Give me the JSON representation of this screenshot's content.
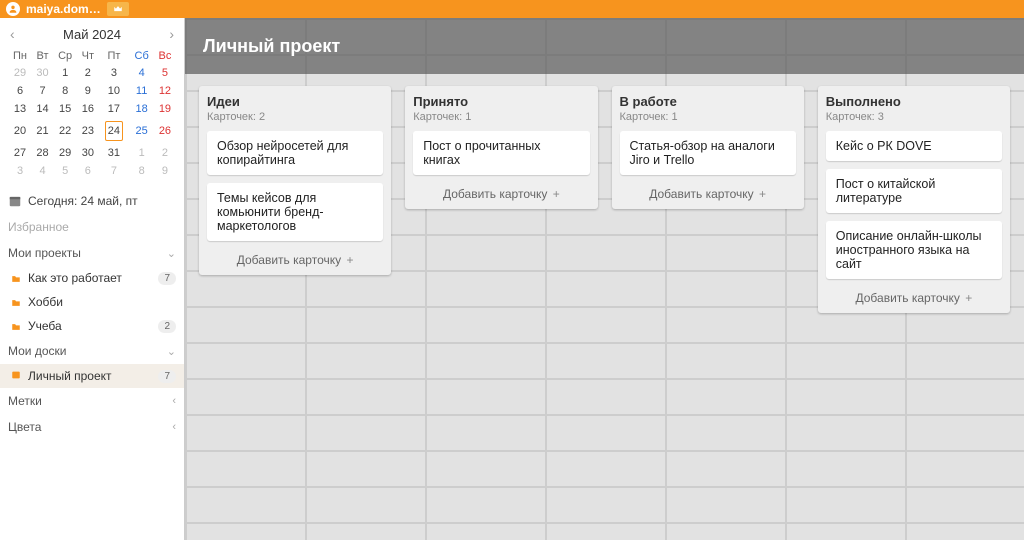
{
  "topbar": {
    "user": "maiya.dom…"
  },
  "calendar": {
    "title": "Май 2024",
    "dow": [
      "Пн",
      "Вт",
      "Ср",
      "Чт",
      "Пт",
      "Сб",
      "Вс"
    ],
    "weeks": [
      [
        {
          "n": 29,
          "cls": "other"
        },
        {
          "n": 30,
          "cls": "other"
        },
        {
          "n": 1
        },
        {
          "n": 2
        },
        {
          "n": 3
        },
        {
          "n": 4,
          "cls": "sat"
        },
        {
          "n": 5,
          "cls": "sun"
        }
      ],
      [
        {
          "n": 6
        },
        {
          "n": 7
        },
        {
          "n": 8
        },
        {
          "n": 9
        },
        {
          "n": 10
        },
        {
          "n": 11,
          "cls": "sat"
        },
        {
          "n": 12,
          "cls": "sun"
        }
      ],
      [
        {
          "n": 13
        },
        {
          "n": 14
        },
        {
          "n": 15
        },
        {
          "n": 16
        },
        {
          "n": 17
        },
        {
          "n": 18,
          "cls": "sat"
        },
        {
          "n": 19,
          "cls": "sun"
        }
      ],
      [
        {
          "n": 20
        },
        {
          "n": 21
        },
        {
          "n": 22
        },
        {
          "n": 23
        },
        {
          "n": 24,
          "today": true
        },
        {
          "n": 25,
          "cls": "sat"
        },
        {
          "n": 26,
          "cls": "sun"
        }
      ],
      [
        {
          "n": 27
        },
        {
          "n": 28
        },
        {
          "n": 29
        },
        {
          "n": 30
        },
        {
          "n": 31
        },
        {
          "n": 1,
          "cls": "other"
        },
        {
          "n": 2,
          "cls": "other"
        }
      ],
      [
        {
          "n": 3,
          "cls": "other"
        },
        {
          "n": 4,
          "cls": "other"
        },
        {
          "n": 5,
          "cls": "other"
        },
        {
          "n": 6,
          "cls": "other"
        },
        {
          "n": 7,
          "cls": "other"
        },
        {
          "n": 8,
          "cls": "other"
        },
        {
          "n": 9,
          "cls": "other"
        }
      ]
    ],
    "today_label": "Сегодня: 24 май, пт"
  },
  "sidebar": {
    "favorites": "Избранное",
    "my_projects": "Мои проекты",
    "projects": [
      {
        "label": "Как это работает",
        "badge": "7"
      },
      {
        "label": "Хобби"
      },
      {
        "label": "Учеба",
        "badge": "2"
      }
    ],
    "my_boards": "Мои доски",
    "boards": [
      {
        "label": "Личный проект",
        "badge": "7",
        "active": true
      }
    ],
    "labels": "Метки",
    "colors": "Цвета"
  },
  "board": {
    "title": "Личный проект",
    "add_card_label": "Добавить карточку",
    "columns": [
      {
        "title": "Идеи",
        "count_label": "Карточек: 2",
        "cards": [
          "Обзор нейросетей для копирайтинга",
          "Темы кейсов для комьюнити бренд-маркетологов"
        ]
      },
      {
        "title": "Принято",
        "count_label": "Карточек: 1",
        "cards": [
          "Пост о прочитанных книгах"
        ]
      },
      {
        "title": "В работе",
        "count_label": "Карточек: 1",
        "cards": [
          "Статья-обзор на аналоги Jiro и Trello"
        ]
      },
      {
        "title": "Выполнено",
        "count_label": "Карточек: 3",
        "cards": [
          "Кейс о РК DOVE",
          "Пост о китайской литературе",
          "Описание онлайн-школы иностранного языка на сайт"
        ]
      }
    ]
  }
}
